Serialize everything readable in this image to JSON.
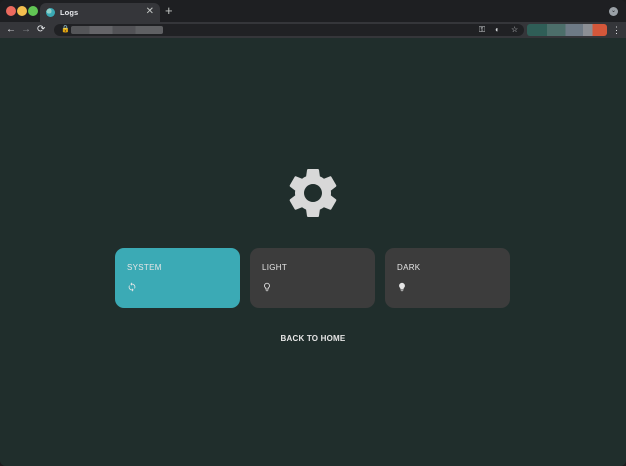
{
  "browser": {
    "tab": {
      "title": "Logs",
      "close_glyph": "✕",
      "favicon": "app-favicon-icon"
    },
    "new_tab_glyph": "+",
    "tab_menu_glyph": "⌄",
    "toolbar": {
      "back_glyph": "←",
      "forward_glyph": "→",
      "reload_glyph": "⟳",
      "lock_glyph": "🔒",
      "key_glyph": "⚿",
      "lens_glyph": "◐",
      "star_glyph": "☆",
      "menu_glyph": "⋮"
    }
  },
  "main": {
    "settings_icon": "gear-icon",
    "theme_options": [
      {
        "label": "SYSTEM",
        "icon": "sync-icon",
        "selected": true
      },
      {
        "label": "LIGHT",
        "icon": "lightbulb-outline-icon",
        "selected": false
      },
      {
        "label": "DARK",
        "icon": "lightbulb-filled-icon",
        "selected": false
      }
    ],
    "back_link": "BACK TO HOME"
  },
  "colors": {
    "background": "#202e2c",
    "accent": "#3baab5",
    "card": "#3c3c3c",
    "gear": "#d8d8d8",
    "text": "#e6e6e6"
  }
}
